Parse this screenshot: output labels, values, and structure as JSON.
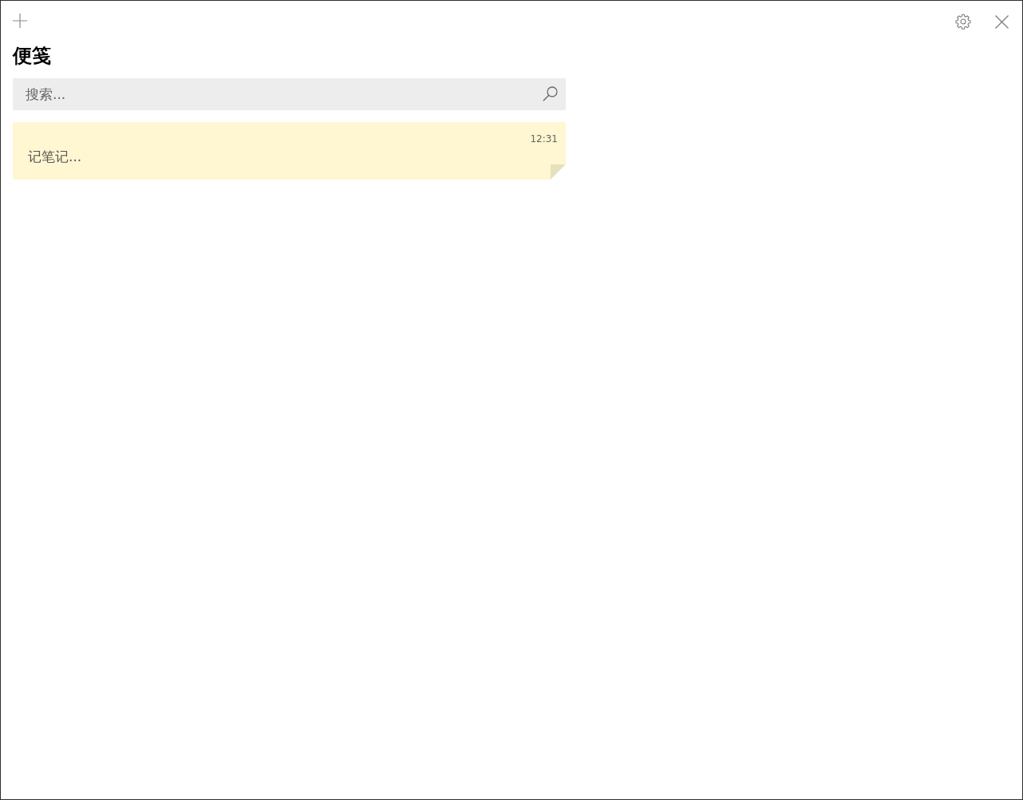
{
  "title": "便笺",
  "search": {
    "placeholder": "搜索..."
  },
  "notes": [
    {
      "time": "12:31",
      "text": "记笔记..."
    }
  ]
}
